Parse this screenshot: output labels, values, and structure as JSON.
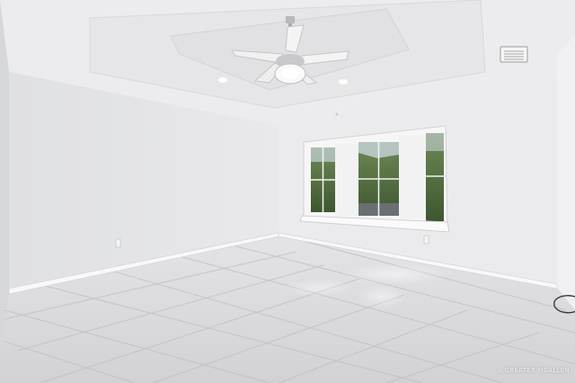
{
  "scene": {
    "kind": "photo",
    "subject": "empty-room-interior",
    "colors": {
      "ceiling": "#ececee",
      "left_wall": "#e4e5e7",
      "back_wall": "#ebebed",
      "right_wall": "#f0f0f2",
      "floor": "#d9d8da",
      "grout": "#bdbcbe",
      "trim": "#f7f7f8",
      "foliage": "#4f6b3c",
      "sky": "#c9d4dc"
    }
  },
  "watermark": {
    "text": "GREATER MCALLEN",
    "icon": "house-logo-icon"
  }
}
